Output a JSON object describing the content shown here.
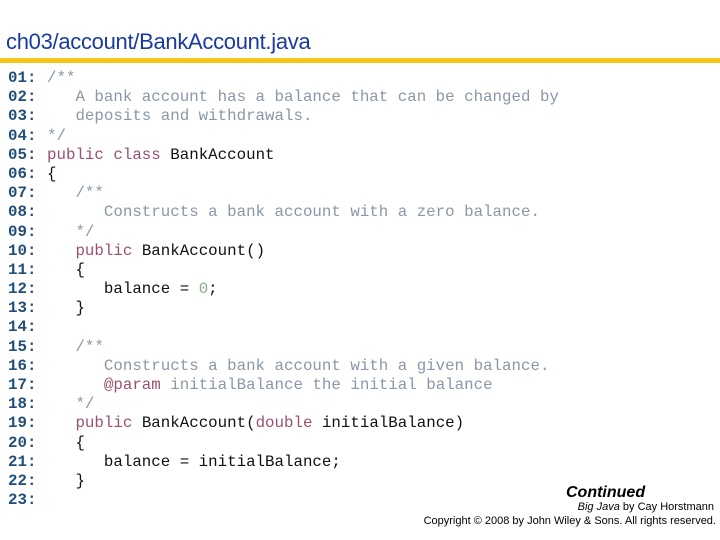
{
  "slide": {
    "title": "ch03/account/BankAccount.java",
    "accent_color": "#f5c518",
    "title_color": "#1a3aa0"
  },
  "code": {
    "lines": [
      {
        "num": "01:",
        "tokens": [
          {
            "t": "comment",
            "v": "/**"
          }
        ]
      },
      {
        "num": "02:",
        "tokens": [
          {
            "t": "comment",
            "v": "   A bank account has a balance that can be changed by"
          }
        ]
      },
      {
        "num": "03:",
        "tokens": [
          {
            "t": "comment",
            "v": "   deposits and withdrawals."
          }
        ]
      },
      {
        "num": "04:",
        "tokens": [
          {
            "t": "comment",
            "v": "*/"
          }
        ]
      },
      {
        "num": "05:",
        "tokens": [
          {
            "t": "keyword",
            "v": "public class "
          },
          {
            "t": "plain",
            "v": "BankAccount"
          }
        ]
      },
      {
        "num": "06:",
        "tokens": [
          {
            "t": "punct",
            "v": "{"
          }
        ]
      },
      {
        "num": "07:",
        "tokens": [
          {
            "t": "comment",
            "v": "   /**"
          }
        ]
      },
      {
        "num": "08:",
        "tokens": [
          {
            "t": "comment",
            "v": "      Constructs a bank account with a zero balance."
          }
        ]
      },
      {
        "num": "09:",
        "tokens": [
          {
            "t": "comment",
            "v": "   */"
          }
        ]
      },
      {
        "num": "10:",
        "tokens": [
          {
            "t": "plain",
            "v": "   "
          },
          {
            "t": "keyword",
            "v": "public "
          },
          {
            "t": "plain",
            "v": "BankAccount()"
          }
        ]
      },
      {
        "num": "11:",
        "tokens": [
          {
            "t": "punct",
            "v": "   {"
          }
        ]
      },
      {
        "num": "12:",
        "tokens": [
          {
            "t": "plain",
            "v": "      balance = "
          },
          {
            "t": "number",
            "v": "0"
          },
          {
            "t": "plain",
            "v": ";"
          }
        ]
      },
      {
        "num": "13:",
        "tokens": [
          {
            "t": "punct",
            "v": "   }"
          }
        ]
      },
      {
        "num": "14:",
        "tokens": []
      },
      {
        "num": "15:",
        "tokens": [
          {
            "t": "comment",
            "v": "   /**"
          }
        ]
      },
      {
        "num": "16:",
        "tokens": [
          {
            "t": "comment",
            "v": "      Constructs a bank account with a given balance."
          }
        ]
      },
      {
        "num": "17:",
        "tokens": [
          {
            "t": "plain",
            "v": "      "
          },
          {
            "t": "tag",
            "v": "@param"
          },
          {
            "t": "comment",
            "v": " initialBalance the initial balance"
          }
        ]
      },
      {
        "num": "18:",
        "tokens": [
          {
            "t": "comment",
            "v": "   */"
          }
        ]
      },
      {
        "num": "19:",
        "tokens": [
          {
            "t": "plain",
            "v": "   "
          },
          {
            "t": "keyword",
            "v": "public "
          },
          {
            "t": "plain",
            "v": "BankAccount("
          },
          {
            "t": "keyword",
            "v": "double "
          },
          {
            "t": "plain",
            "v": "initialBalance)"
          }
        ]
      },
      {
        "num": "20:",
        "tokens": [
          {
            "t": "punct",
            "v": "   {"
          }
        ]
      },
      {
        "num": "21:",
        "tokens": [
          {
            "t": "plain",
            "v": "      balance = initialBalance;"
          }
        ]
      },
      {
        "num": "22:",
        "tokens": [
          {
            "t": "punct",
            "v": "   }"
          }
        ]
      },
      {
        "num": "23:",
        "tokens": []
      }
    ]
  },
  "footer": {
    "continued": "Continued",
    "book_title": "Big Java",
    "book_author": " by Cay Horstmann",
    "copyright": "Copyright © 2008 by John Wiley & Sons.  All rights reserved."
  }
}
